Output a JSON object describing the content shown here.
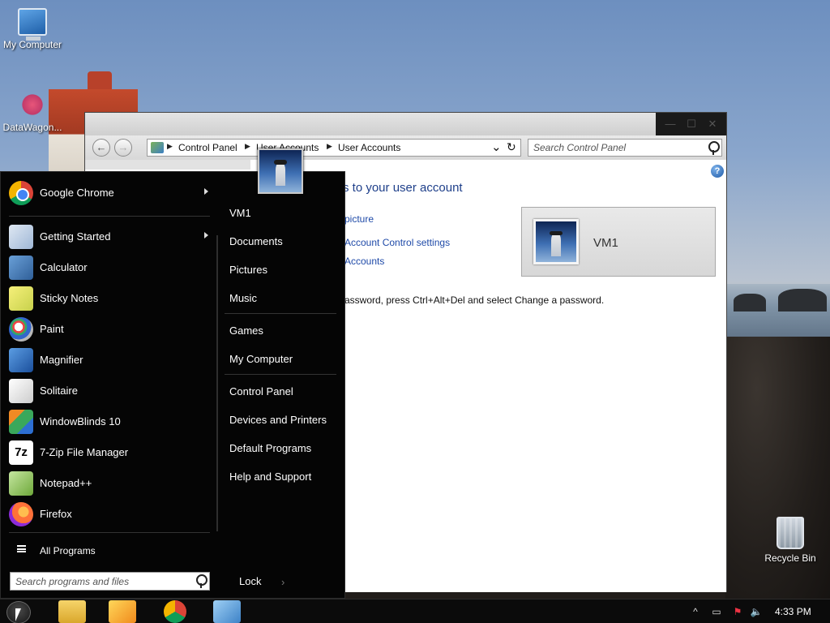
{
  "desktop": {
    "icons": [
      {
        "label": "My Computer",
        "icon": "my-computer-icon"
      },
      {
        "label": "DataWagon...",
        "icon": "datawagon-icon"
      },
      {
        "label": "Recycle Bin",
        "icon": "recycle-bin-icon"
      }
    ]
  },
  "control_panel": {
    "breadcrumb": [
      "Control Panel",
      "User Accounts",
      "User Accounts"
    ],
    "search_placeholder": "Search Control Panel",
    "heading": "s to your user account",
    "links": [
      "picture",
      "Account Control settings",
      "Accounts"
    ],
    "note": "assword, press Ctrl+Alt+Del and select Change a password.",
    "user_name": "VM1"
  },
  "start_menu": {
    "programs": [
      {
        "label": "Google Chrome",
        "icon": "chrome-icon",
        "submenu": true
      },
      {
        "label": "Getting Started",
        "icon": "getting-started-icon",
        "submenu": true
      },
      {
        "label": "Calculator",
        "icon": "calculator-icon",
        "submenu": false
      },
      {
        "label": "Sticky Notes",
        "icon": "sticky-notes-icon",
        "submenu": false
      },
      {
        "label": "Paint",
        "icon": "paint-icon",
        "submenu": false
      },
      {
        "label": "Magnifier",
        "icon": "magnifier-icon",
        "submenu": false
      },
      {
        "label": "Solitaire",
        "icon": "solitaire-icon",
        "submenu": false
      },
      {
        "label": "WindowBlinds 10",
        "icon": "windowblinds-icon",
        "submenu": false
      },
      {
        "label": "7-Zip File Manager",
        "icon": "7zip-icon",
        "submenu": false
      },
      {
        "label": "Notepad++",
        "icon": "notepad-plus-plus-icon",
        "submenu": false
      },
      {
        "label": "Firefox",
        "icon": "firefox-icon",
        "submenu": false
      }
    ],
    "all_programs": "All Programs",
    "search_placeholder": "Search programs and files",
    "right_items": [
      "VM1",
      "Documents",
      "Pictures",
      "Music",
      "Games",
      "My Computer",
      "Control Panel",
      "Devices and Printers",
      "Default Programs",
      "Help and Support"
    ],
    "lock_label": "Lock",
    "lock_arrow": "›",
    "seven_zip_glyph": "7z"
  },
  "taskbar": {
    "pinned": [
      "file-explorer-icon",
      "media-player-icon",
      "chrome-icon",
      "control-panel-icon"
    ],
    "tray": [
      "show-hidden-icons-icon",
      "network-icon",
      "action-center-icon",
      "volume-icon"
    ],
    "clock": "4:33 PM"
  },
  "glyphs": {
    "back": "←",
    "forward": "→",
    "crumb_separator": "▶",
    "dropdown": "⌄",
    "refresh": "↻",
    "help": "?",
    "minimize": "—",
    "maximize": "☐",
    "close": "✕",
    "tray": [
      "^",
      "▭",
      "⚑",
      "🔈"
    ],
    "address_chevron": "«"
  }
}
